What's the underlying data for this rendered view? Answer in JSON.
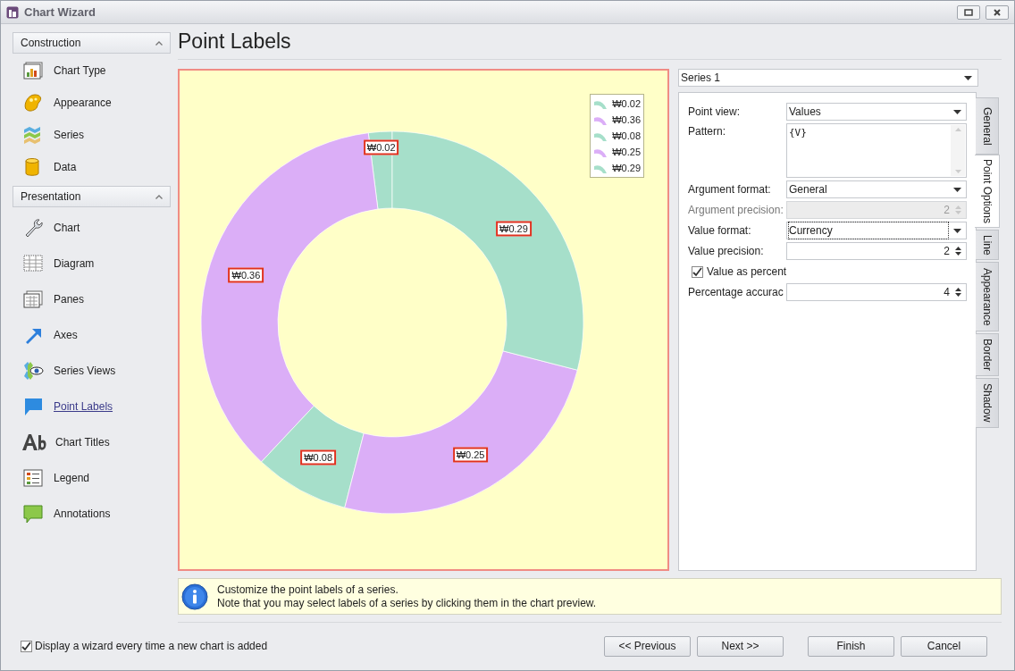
{
  "window": {
    "title": "Chart Wizard"
  },
  "sidebar": {
    "groups": [
      {
        "title": "Construction",
        "expanded": true,
        "items": [
          {
            "label": "Chart Type",
            "selected": false
          },
          {
            "label": "Appearance",
            "selected": false
          },
          {
            "label": "Series",
            "selected": false
          },
          {
            "label": "Data",
            "selected": false
          }
        ]
      },
      {
        "title": "Presentation",
        "expanded": true,
        "items": [
          {
            "label": "Chart",
            "selected": false
          },
          {
            "label": "Diagram",
            "selected": false
          },
          {
            "label": "Panes",
            "selected": false
          },
          {
            "label": "Axes",
            "selected": false
          },
          {
            "label": "Series Views",
            "selected": false
          },
          {
            "label": "Point Labels",
            "selected": true
          },
          {
            "label": "Chart Titles",
            "selected": false
          },
          {
            "label": "Legend",
            "selected": false
          },
          {
            "label": "Annotations",
            "selected": false
          }
        ]
      }
    ]
  },
  "page_title": "Point Labels",
  "chart": {
    "chart_data": {
      "type": "donut",
      "values": [
        0.02,
        0.36,
        0.08,
        0.25,
        0.29
      ],
      "value_labels": [
        "₩0.02",
        "₩0.36",
        "₩0.08",
        "₩0.25",
        "₩0.29"
      ]
    },
    "legend": [
      {
        "label": "₩0.02",
        "color": "#a6dfca"
      },
      {
        "label": "₩0.36",
        "color": "#dbaef7"
      },
      {
        "label": "₩0.08",
        "color": "#a6dfca"
      },
      {
        "label": "₩0.25",
        "color": "#dbaef7"
      },
      {
        "label": "₩0.29",
        "color": "#a6dfca"
      }
    ]
  },
  "series_select": {
    "value": "Series 1"
  },
  "tabs": [
    {
      "label": "General",
      "selected": false
    },
    {
      "label": "Point Options",
      "selected": true
    },
    {
      "label": "Line",
      "selected": false
    },
    {
      "label": "Appearance",
      "selected": false
    },
    {
      "label": "Border",
      "selected": false
    },
    {
      "label": "Shadow",
      "selected": false
    }
  ],
  "fields": [
    {
      "kind": "combo",
      "label": "Point view:",
      "value": "Values",
      "disabled": false
    },
    {
      "kind": "memo",
      "label": "Pattern:",
      "value": "{V}",
      "disabled": false
    },
    {
      "kind": "combo",
      "label": "Argument format:",
      "value": "General",
      "disabled": false
    },
    {
      "kind": "spin",
      "label": "Argument precision:",
      "value": "2",
      "disabled": true
    },
    {
      "kind": "combo",
      "label": "Value format:",
      "value": "Currency",
      "disabled": false
    },
    {
      "kind": "spin",
      "label": "Value precision:",
      "value": "2",
      "disabled": false
    },
    {
      "kind": "check",
      "label": "Value as percent",
      "checked": true
    },
    {
      "kind": "spin",
      "label": "Percentage accurac",
      "value": "4",
      "disabled": false
    }
  ],
  "info": {
    "lines": [
      "Customize the point labels of a series.",
      "Note that you may select labels of a series by clicking them in the chart preview."
    ]
  },
  "footer": {
    "checkbox": {
      "label": "Display a wizard every time a new chart is added",
      "checked": true
    },
    "buttons": [
      "<< Previous",
      "Next >>",
      "Finish",
      "Cancel"
    ]
  }
}
